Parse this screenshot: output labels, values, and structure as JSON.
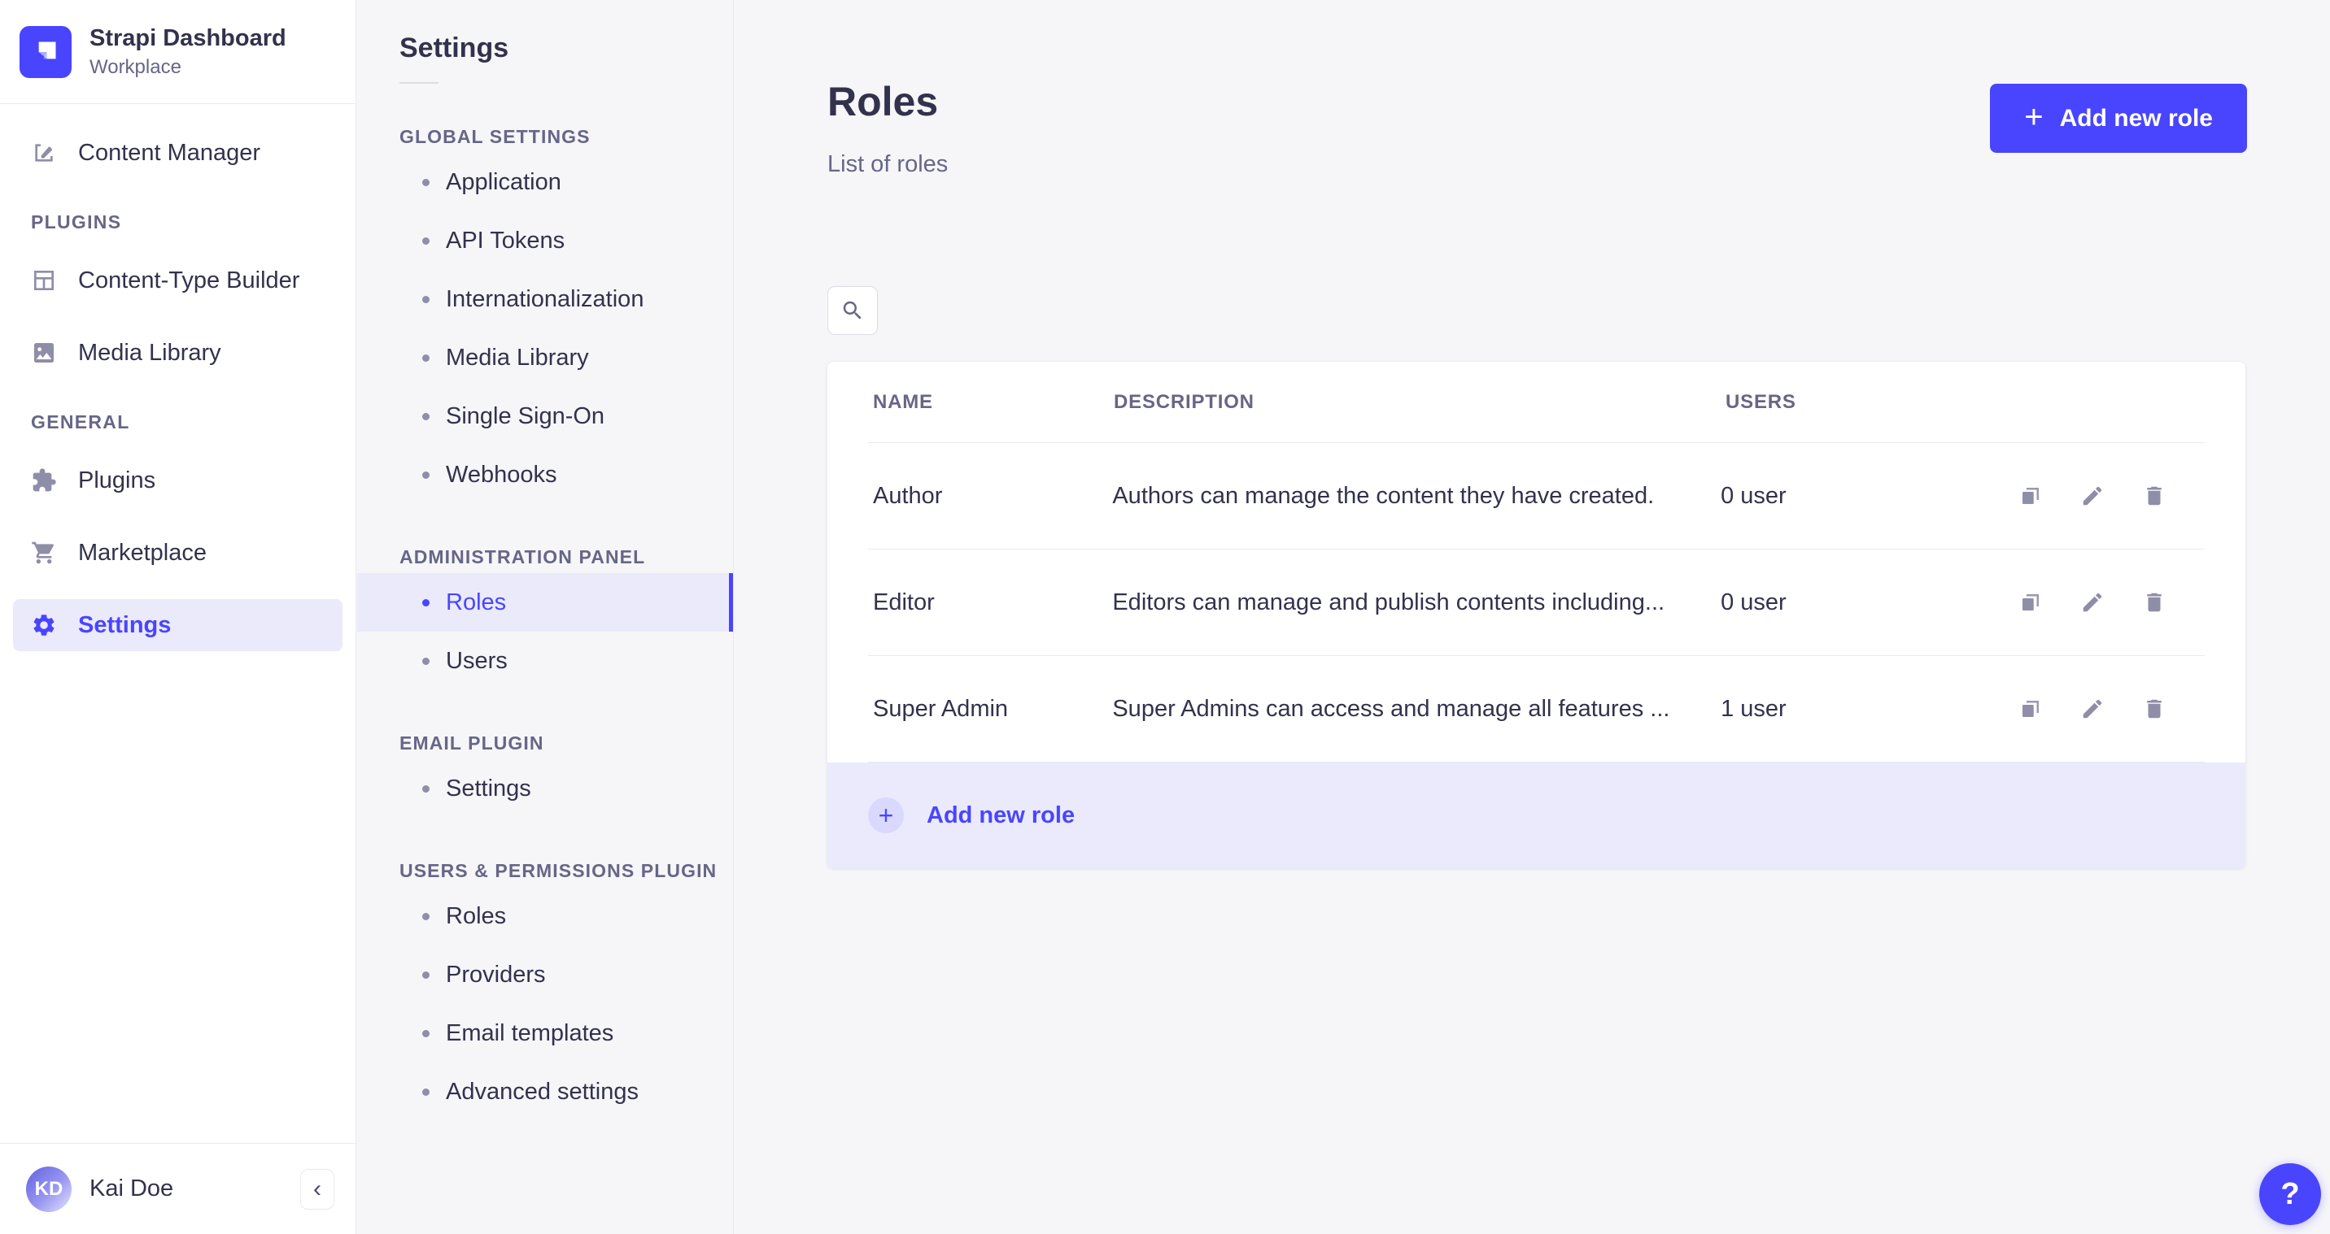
{
  "colors": {
    "accent": "#4945ff",
    "accent_light_bg": "#eaeafb",
    "footer_bg": "#eaeafc",
    "text_dark": "#32324d",
    "text_muted": "#666687",
    "icon_gray": "#8e8ea9",
    "page_bg": "#f6f6f9",
    "border": "#eaeaef"
  },
  "icons": {
    "plus": "+",
    "collapse": "‹",
    "help": "?"
  },
  "app": {
    "name": "Strapi Dashboard",
    "workspace": "Workplace",
    "user_initials": "KD",
    "user_name": "Kai Doe"
  },
  "sidebar": {
    "root_item": "Content Manager",
    "sections": [
      {
        "title": "PLUGINS",
        "items": [
          "Content-Type Builder",
          "Media Library"
        ]
      },
      {
        "title": "GENERAL",
        "items": [
          "Plugins",
          "Marketplace",
          "Settings"
        ]
      }
    ]
  },
  "settings_nav": {
    "title": "Settings",
    "sections": [
      {
        "title": "GLOBAL SETTINGS",
        "items": [
          "Application",
          "API Tokens",
          "Internationalization",
          "Media Library",
          "Single Sign-On",
          "Webhooks"
        ]
      },
      {
        "title": "ADMINISTRATION PANEL",
        "items": [
          "Roles",
          "Users"
        ],
        "active_item": "Roles"
      },
      {
        "title": "EMAIL PLUGIN",
        "items": [
          "Settings"
        ]
      },
      {
        "title": "USERS & PERMISSIONS PLUGIN",
        "items": [
          "Roles",
          "Providers",
          "Email templates",
          "Advanced settings"
        ]
      }
    ]
  },
  "main": {
    "page_title": "Roles",
    "page_subtitle": "List of roles",
    "add_button_label": "Add new role",
    "table": {
      "columns": [
        "NAME",
        "DESCRIPTION",
        "USERS"
      ],
      "rows": [
        {
          "name": "Author",
          "description": "Authors can manage the content they have created.",
          "users": "0 user"
        },
        {
          "name": "Editor",
          "description": "Editors can manage and publish contents including...",
          "users": "0 user"
        },
        {
          "name": "Super Admin",
          "description": "Super Admins can access and manage all features ...",
          "users": "1 user"
        }
      ],
      "footer_add_label": "Add new role"
    }
  }
}
